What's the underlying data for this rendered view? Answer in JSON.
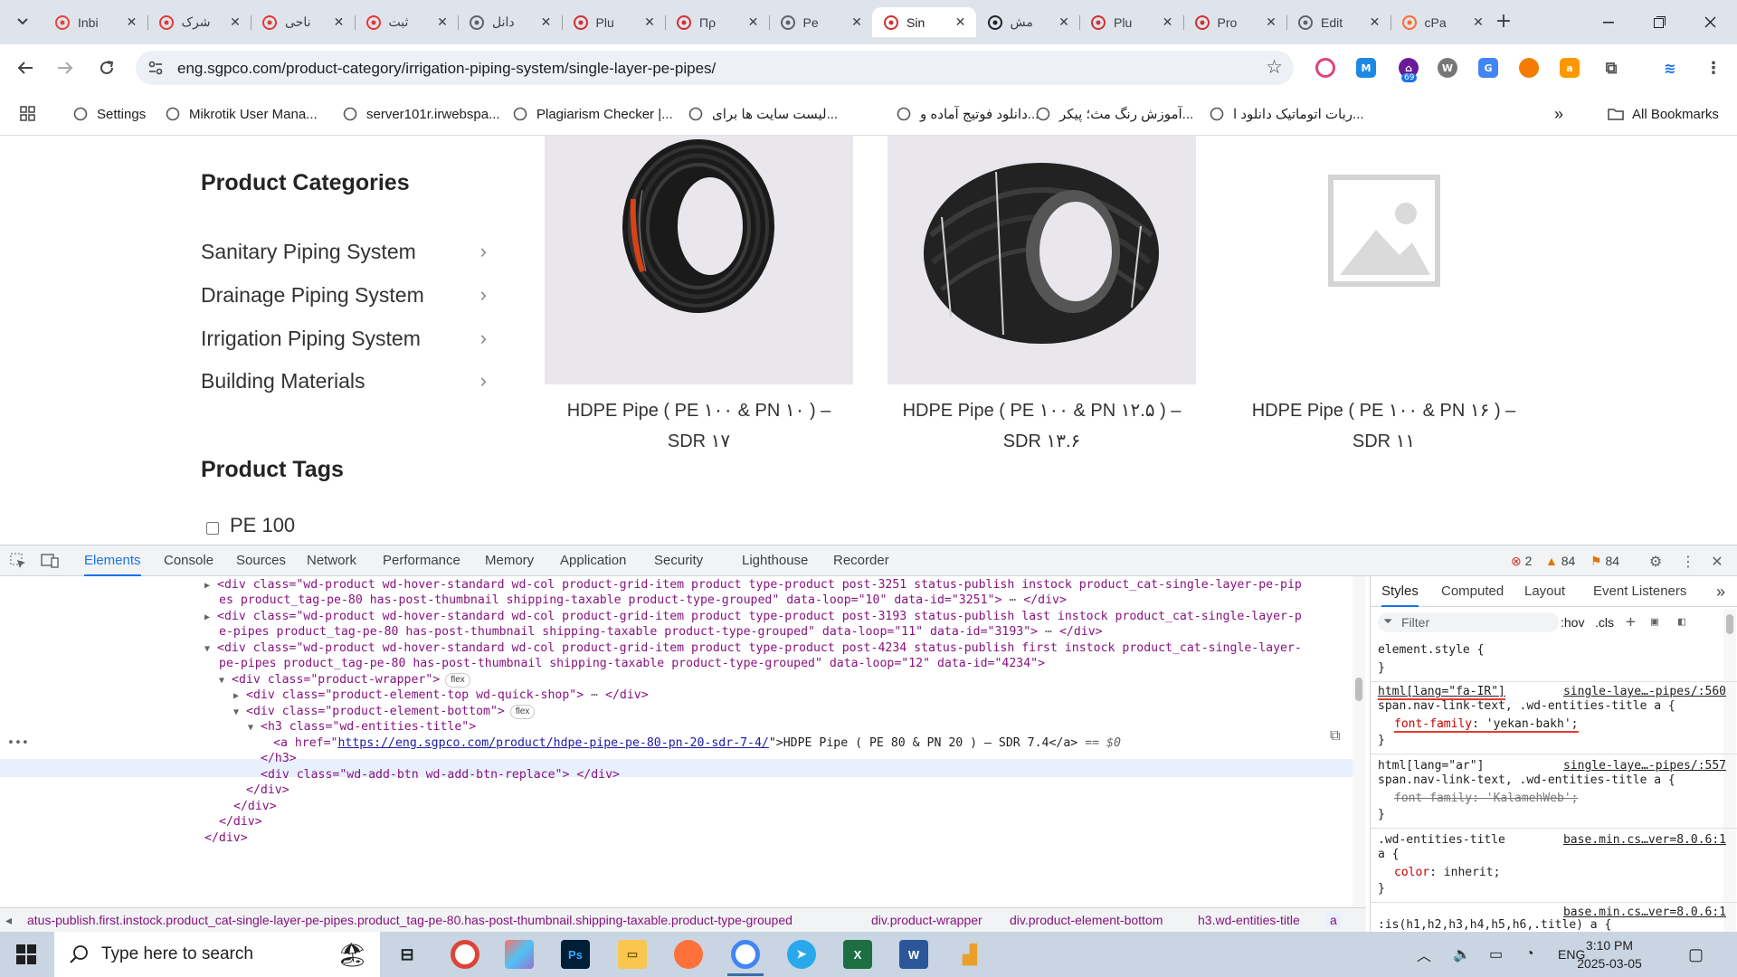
{
  "browser": {
    "tabs": [
      {
        "title": "Inbi",
        "icon": "gmail-icon",
        "color": "#ea4335",
        "active": false
      },
      {
        "title": "شرک",
        "icon": "opera-icon",
        "color": "#e53935",
        "active": false
      },
      {
        "title": "ناحی",
        "icon": "target-icon",
        "color": "#e53935",
        "active": false
      },
      {
        "title": "ثبت",
        "icon": "target-icon",
        "color": "#e53935",
        "active": false
      },
      {
        "title": "دانل",
        "icon": "globe-icon",
        "color": "#5f6368",
        "active": false
      },
      {
        "title": "Plu",
        "icon": "sgpco-icon",
        "color": "#d32f2f",
        "active": false
      },
      {
        "title": "Πρ",
        "icon": "sgpco-icon",
        "color": "#d32f2f",
        "active": false
      },
      {
        "title": "Pe",
        "icon": "globe-icon",
        "color": "#5f6368",
        "active": false
      },
      {
        "title": "Sin",
        "icon": "sgpco-icon",
        "color": "#d32f2f",
        "active": true
      },
      {
        "title": "مش",
        "icon": "chatgpt-icon",
        "color": "#202124",
        "active": false
      },
      {
        "title": "Plu",
        "icon": "sgpco-icon",
        "color": "#d32f2f",
        "active": false
      },
      {
        "title": "Pro",
        "icon": "sgpco-icon",
        "color": "#d32f2f",
        "active": false
      },
      {
        "title": "Edit",
        "icon": "globe-icon",
        "color": "#5f6368",
        "active": false
      },
      {
        "title": "cPa",
        "icon": "cpanel-icon",
        "color": "#ff6c2c",
        "active": false
      }
    ],
    "url": "eng.sgpco.com/product-category/irrigation-piping-system/single-layer-pe-pipes/",
    "extension_badge": "69",
    "bookmarks": [
      {
        "label": "Settings",
        "icon": "gear-icon"
      },
      {
        "label": "Mikrotik User Mana...",
        "icon": "globe-icon"
      },
      {
        "label": "server101r.irwebspa...",
        "icon": "arrow-icon"
      },
      {
        "label": "Plagiarism Checker |...",
        "icon": "plagiarism-icon"
      },
      {
        "label": "لیست سایت ها برای...",
        "icon": "folder-icon"
      },
      {
        "label": "دانلود فوتیج آماده و...",
        "icon": "gfx-icon"
      },
      {
        "label": "آموزش رنگ مث؛ پیکر...",
        "icon": "leaf-icon"
      },
      {
        "label": "ربات اتوماتیک دانلود ا...",
        "icon": "loading-icon"
      }
    ],
    "all_bookmarks": "All Bookmarks"
  },
  "page": {
    "categories_heading": "Product Categories",
    "categories": [
      "Sanitary Piping System",
      "Drainage Piping System",
      "Irrigation Piping System",
      "Building Materials"
    ],
    "tags_heading": "Product Tags",
    "tags": [
      "PE 100"
    ],
    "products": [
      {
        "title_line1": "HDPE Pipe ( PE ۱۰۰ & PN ۱۰ ) –",
        "title_line2": "SDR ۱۷",
        "image": "coil-pipe-image"
      },
      {
        "title_line1": "HDPE Pipe ( PE ۱۰۰ & PN ۱۲.۵ ) –",
        "title_line2": "SDR ۱۳.۶",
        "image": "coil-pipe-image"
      },
      {
        "title_line1": "HDPE Pipe ( PE ۱۰۰ & PN ۱۶ ) –",
        "title_line2": "SDR ۱۱",
        "image": "placeholder-image"
      }
    ]
  },
  "devtools": {
    "tabs": [
      "Elements",
      "Console",
      "Sources",
      "Network",
      "Performance",
      "Memory",
      "Application",
      "Security",
      "Lighthouse",
      "Recorder"
    ],
    "errors": "2",
    "warnings": "84",
    "issues": "84",
    "dom": {
      "l1a": "<div class=\"wd-product wd-hover-standard wd-col product-grid-item product type-product post-3251 status-publish instock product_cat-single-layer-pe-pip",
      "l1b": "es product_tag-pe-80 has-post-thumbnail shipping-taxable product-type-grouped\" data-loop=\"10\" data-id=\"3251\">",
      "l2a": "<div class=\"wd-product wd-hover-standard wd-col product-grid-item product type-product post-3193 status-publish last instock product_cat-single-layer-p",
      "l2b": "e-pipes product_tag-pe-80 has-post-thumbnail shipping-taxable product-type-grouped\" data-loop=\"11\" data-id=\"3193\">",
      "l3a": "<div class=\"wd-product wd-hover-standard wd-col product-grid-item product type-product post-4234 status-publish first instock product_cat-single-layer-",
      "l3b": "pe-pipes product_tag-pe-80 has-post-thumbnail shipping-taxable product-type-grouped\" data-loop=\"12\" data-id=\"4234\">",
      "l4": "<div class=\"product-wrapper\">",
      "l5": "<div class=\"product-element-top wd-quick-shop\">",
      "l6": "<div class=\"product-element-bottom\">",
      "l7": "<h3 class=\"wd-entities-title\">",
      "l8_pre": "<a href=\"",
      "l8_href": "https://eng.sgpco.com/product/hdpe-pipe-pe-80-pn-20-sdr-7-4/",
      "l8_text": "\">HDPE Pipe ( PE 80 & PN 20 ) – SDR 7.4</a>",
      "l8_eq": " == $0",
      "l9": "</h3>",
      "l10": "<div class=\"wd-add-btn wd-add-btn-replace\"> </div>",
      "l11": "</div>",
      "l12": "</div>",
      "l13": "</div>",
      "l14": "</div>",
      "flex": "flex",
      "close_div": "</div>"
    },
    "breadcrumb": [
      "atus-publish.first.instock.product_cat-single-layer-pe-pipes.product_tag-pe-80.has-post-thumbnail.shipping-taxable.product-type-grouped",
      "div.product-wrapper",
      "div.product-element-bottom",
      "h3.wd-entities-title",
      "a"
    ],
    "styles": {
      "tabs": [
        "Styles",
        "Computed",
        "Layout",
        "Event Listeners"
      ],
      "filter_placeholder": "Filter",
      "hov": ":hov",
      "cls": ".cls",
      "element_style": "element.style {",
      "close": "}",
      "rule1_sel1": "html[lang=\"fa-IR\"]",
      "rule1_src": "single-laye…-pipes/:560",
      "rule1_sel2": "span.nav-link-text, .wd-entities-title a {",
      "rule1_prop": "font-family",
      "rule1_val": ": 'yekan-bakh';",
      "rule2_sel1": "html[lang=\"ar\"]",
      "rule2_src": "single-laye…-pipes/:557",
      "rule2_sel2": "span.nav-link-text, .wd-entities-title a {",
      "rule2_prop": "font-family: 'KalamehWeb';",
      "rule3_sel": ".wd-entities-title",
      "rule3_src": "base.min.cs…ver=8.0.6:1",
      "rule3_sel2": "a {",
      "rule3_prop": "color",
      "rule3_val": ": inherit;",
      "rule4_src": "base.min.cs…ver=8.0.6:1",
      "rule4_sel": ":is(h1,h2,h3,h4,h5,h6,.title) a {"
    }
  },
  "taskbar": {
    "search_placeholder": "Type here to search",
    "lang": "ENG",
    "time": "3:10 PM",
    "date": "2025-03-05"
  }
}
